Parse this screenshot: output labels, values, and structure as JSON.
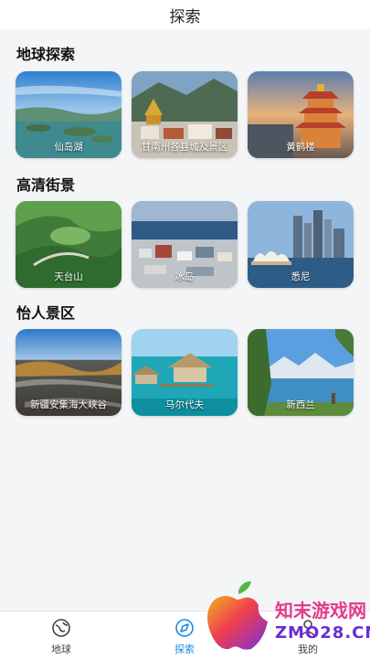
{
  "header": {
    "title": "探索"
  },
  "sections": [
    {
      "title": "地球探索",
      "cards": [
        "仙岛湖",
        "甘南州各县城及景区",
        "黄鹤楼"
      ]
    },
    {
      "title": "高清街景",
      "cards": [
        "天台山",
        "冰岛",
        "悉尼"
      ]
    },
    {
      "title": "怡人景区",
      "cards": [
        "新疆安集海大峡谷",
        "马尔代夫",
        "新西兰"
      ]
    }
  ],
  "tabbar": {
    "tabs": [
      {
        "label": "地球",
        "icon": "earth-icon"
      },
      {
        "label": "探索",
        "icon": "explore-icon",
        "active": true
      },
      {
        "label": "我的",
        "icon": "user-icon"
      }
    ]
  },
  "watermark": {
    "line1": "知末游戏网",
    "line2": "ZMO28.CN"
  },
  "colors": {
    "accent": "#1e88e5",
    "background": "#f4f5f7"
  }
}
